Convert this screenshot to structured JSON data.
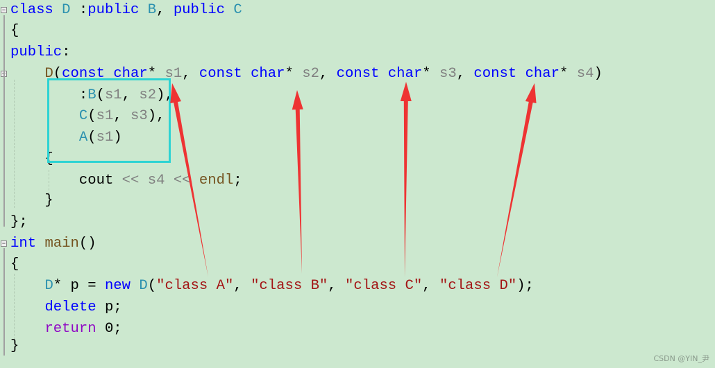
{
  "code_lines": [
    [
      [
        "class ",
        "kw"
      ],
      [
        "D ",
        "ty"
      ],
      [
        ":",
        "pl"
      ],
      [
        "public ",
        "kw"
      ],
      [
        "B",
        "ty"
      ],
      [
        ", ",
        "pl"
      ],
      [
        "public ",
        "kw"
      ],
      [
        "C",
        "ty"
      ]
    ],
    [
      [
        "{",
        "pl"
      ]
    ],
    [
      [
        "public",
        "kw"
      ],
      [
        ":",
        "pl"
      ]
    ],
    [
      [
        "    ",
        "pl"
      ],
      [
        "D",
        "fn"
      ],
      [
        "(",
        "pl"
      ],
      [
        "const ",
        "kw"
      ],
      [
        "char",
        "kw"
      ],
      [
        "* ",
        "pl"
      ],
      [
        "s1",
        "pa"
      ],
      [
        ", ",
        "pl"
      ],
      [
        "const ",
        "kw"
      ],
      [
        "char",
        "kw"
      ],
      [
        "* ",
        "pl"
      ],
      [
        "s2",
        "pa"
      ],
      [
        ", ",
        "pl"
      ],
      [
        "const ",
        "kw"
      ],
      [
        "char",
        "kw"
      ],
      [
        "* ",
        "pl"
      ],
      [
        "s3",
        "pa"
      ],
      [
        ", ",
        "pl"
      ],
      [
        "const ",
        "kw"
      ],
      [
        "char",
        "kw"
      ],
      [
        "* ",
        "pl"
      ],
      [
        "s4",
        "pa"
      ],
      [
        ")",
        "pl"
      ]
    ],
    [
      [
        "        :",
        "pl"
      ],
      [
        "B",
        "ty"
      ],
      [
        "(",
        "pl"
      ],
      [
        "s1",
        "pa"
      ],
      [
        ", ",
        "pl"
      ],
      [
        "s2",
        "pa"
      ],
      [
        "),",
        "pl"
      ]
    ],
    [
      [
        "        ",
        "pl"
      ],
      [
        "C",
        "ty"
      ],
      [
        "(",
        "pl"
      ],
      [
        "s1",
        "pa"
      ],
      [
        ", ",
        "pl"
      ],
      [
        "s3",
        "pa"
      ],
      [
        "),",
        "pl"
      ]
    ],
    [
      [
        "        ",
        "pl"
      ],
      [
        "A",
        "ty"
      ],
      [
        "(",
        "pl"
      ],
      [
        "s1",
        "pa"
      ],
      [
        ")",
        "pl"
      ]
    ],
    [
      [
        "    {",
        "pl"
      ]
    ],
    [
      [
        "        cout ",
        "pl"
      ],
      [
        "<< ",
        "pa"
      ],
      [
        "s4 ",
        "pa"
      ],
      [
        "<< ",
        "pa"
      ],
      [
        "endl",
        "fn"
      ],
      [
        ";",
        "pl"
      ]
    ],
    [
      [
        "    }",
        "pl"
      ]
    ],
    [
      [
        "};",
        "pl"
      ]
    ],
    [
      [
        "int ",
        "kw"
      ],
      [
        "main",
        "fn"
      ],
      [
        "()",
        "pl"
      ]
    ],
    [
      [
        "{",
        "pl"
      ]
    ],
    [
      [
        "    ",
        "pl"
      ],
      [
        "D",
        "ty"
      ],
      [
        "* p = ",
        "pl"
      ],
      [
        "new ",
        "kw"
      ],
      [
        "D",
        "ty"
      ],
      [
        "(",
        "pl"
      ],
      [
        "\"class A\"",
        "st"
      ],
      [
        ", ",
        "pl"
      ],
      [
        "\"class B\"",
        "st"
      ],
      [
        ", ",
        "pl"
      ],
      [
        "\"class C\"",
        "st"
      ],
      [
        ", ",
        "pl"
      ],
      [
        "\"class D\"",
        "st"
      ],
      [
        ");",
        "pl"
      ]
    ],
    [
      [
        "    ",
        "pl"
      ],
      [
        "delete ",
        "kw"
      ],
      [
        "p;",
        "pl"
      ]
    ],
    [
      [
        "    ",
        "pl"
      ],
      [
        "return ",
        "rt"
      ],
      [
        "0;",
        "pl"
      ]
    ],
    [
      [
        "}",
        "pl"
      ]
    ]
  ],
  "watermark": "CSDN @YIN_尹",
  "colors": {
    "arrow": "#ee3333",
    "highlight_box": "#2dd3d3",
    "background": "#cce8cf"
  }
}
